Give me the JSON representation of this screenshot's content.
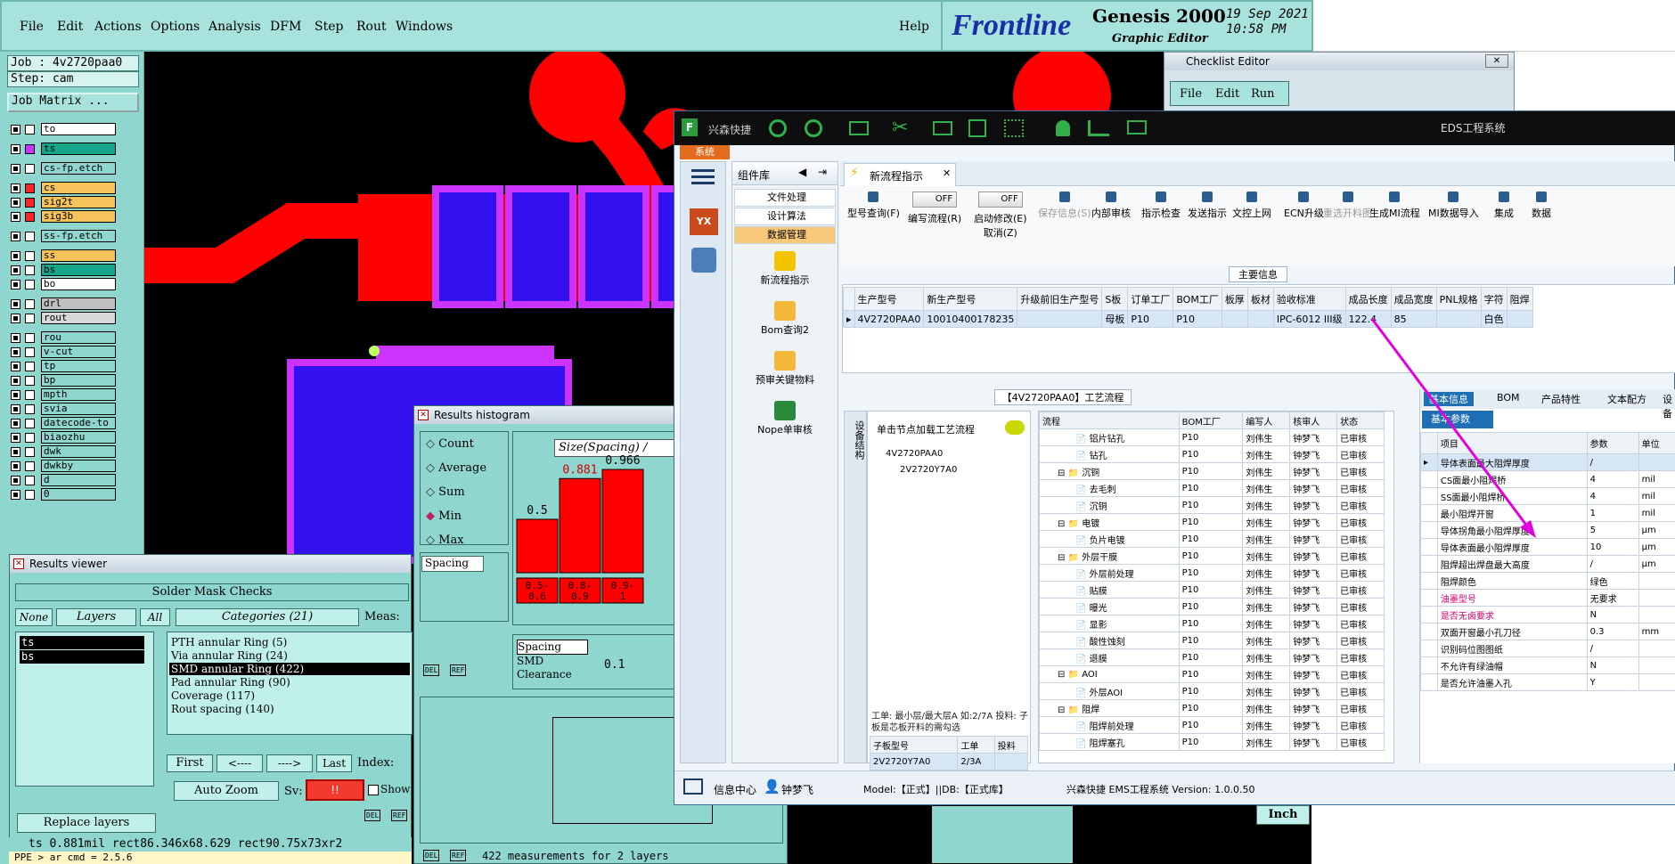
{
  "genesis": {
    "menu": [
      "File",
      "Edit",
      "Actions",
      "Options",
      "Analysis",
      "DFM",
      "Step",
      "Rout",
      "Windows"
    ],
    "help": "Help",
    "brand": "Frontline",
    "product": "Genesis 2000",
    "subtitle": "Graphic Editor",
    "date": "19 Sep 2021",
    "time": "10:58 PM",
    "job": "Job : 4v2720paa0",
    "step": "Step: cam",
    "job_matrix": "Job Matrix ...",
    "layers": [
      {
        "name": "to",
        "color": "#ffffff"
      },
      {
        "name": "ts",
        "color": "#17a589"
      },
      {
        "name": "cs-fp.etch",
        "color": "#8fd6cf"
      },
      {
        "name": "cs",
        "color": "#f6c35a"
      },
      {
        "name": "sig2t",
        "color": "#f6c35a"
      },
      {
        "name": "sig3b",
        "color": "#f6c35a"
      },
      {
        "name": "ss-fp.etch",
        "color": "#8fd6cf"
      },
      {
        "name": "ss",
        "color": "#f6c35a"
      },
      {
        "name": "bs",
        "color": "#17a589"
      },
      {
        "name": "bo",
        "color": "#ffffff"
      },
      {
        "name": "drl",
        "color": "#c0c0c0"
      },
      {
        "name": "rout",
        "color": "#d8d8d8"
      },
      {
        "name": "rou",
        "color": "#8fd6cf"
      },
      {
        "name": "v-cut",
        "color": "#8fd6cf"
      },
      {
        "name": "tp",
        "color": "#8fd6cf"
      },
      {
        "name": "bp",
        "color": "#8fd6cf"
      },
      {
        "name": "mpth",
        "color": "#8fd6cf"
      },
      {
        "name": "svia",
        "color": "#8fd6cf"
      },
      {
        "name": "datecode-to",
        "color": "#8fd6cf"
      },
      {
        "name": "biaozhu",
        "color": "#8fd6cf"
      },
      {
        "name": "dwk",
        "color": "#8fd6cf"
      },
      {
        "name": "dwkby",
        "color": "#8fd6cf"
      },
      {
        "name": "d",
        "color": "#8fd6cf"
      },
      {
        "name": "0",
        "color": "#8fd6cf"
      }
    ],
    "results_viewer": {
      "title": "Results viewer",
      "header": "Solder Mask Checks",
      "none": "None",
      "layers": "Layers",
      "all": "All",
      "categories": "Categories (21)",
      "meas": "Meas:",
      "layer_list": [
        "ts",
        "bs"
      ],
      "cats": [
        "PTH annular Ring (5)",
        "Via annular Ring (24)",
        "SMD annular Ring (422)",
        "Pad annular Ring (90)",
        "Coverage (117)",
        "Rout spacing (140)"
      ],
      "first": "First",
      "prev": "<----",
      "next": "---->",
      "last": "Last",
      "index": "Index:",
      "auto_zoom": "Auto Zoom",
      "sv": "Sv:",
      "sv_val": "!!",
      "show": "Show",
      "replace": "Replace layers",
      "del": "DEL",
      "ref": "REF",
      "status1": "ts  0.881mil   rect86.346x68.629   rect90.75x73xr2",
      "status2": "PPE  > ar cmd = 2.5.6"
    },
    "histogram": {
      "title": "Results histogram",
      "options": [
        "Count",
        "Average",
        "Sum",
        "Min",
        "Max"
      ],
      "chart_title": "Size(Spacing) /",
      "spacing": "Spacing",
      "types": [
        "Spacing",
        "SMD",
        "Clearance"
      ],
      "min_val": "0.1",
      "measurements": "422 measurements for 2 layers",
      "del": "DEL",
      "ref": "REF",
      "inch": "Inch"
    },
    "checklist": {
      "title": "Checklist Editor",
      "menu": [
        "File",
        "Edit",
        "Run"
      ]
    }
  },
  "chart_data": {
    "type": "bar",
    "title": "Size(Spacing) /",
    "categories": [
      "0.5-0.6",
      "0.8-0.9",
      "0.9-1"
    ],
    "data_labels": [
      "0.5",
      "0.881",
      "0.966"
    ],
    "values": [
      0.5,
      0.881,
      0.966
    ]
  },
  "eds": {
    "app_name": "兴森快捷",
    "window_title": "EDS工程系统",
    "system_tab": "系统",
    "sidebar_title": "组件库",
    "sidebar_items": [
      "文件处理",
      "设计算法",
      "数据管理"
    ],
    "sidebar_icons": [
      "新流程指示",
      "Bom查询2",
      "预审关键物料",
      "Nope单审核"
    ],
    "tab": "新流程指示",
    "toolbar": [
      "型号查询(F)",
      "编写流程(R)",
      "启动修改(E)",
      "保存信息(S)",
      "内部审核",
      "指示检查",
      "发送指示",
      "文控上网",
      "ECN升级",
      "重选开料图",
      "生成MI流程",
      "MI数据导入",
      "集成",
      "数据"
    ],
    "toolbar_extra": "取消(Z)",
    "off": "OFF",
    "main_info": "主要信息",
    "main_cols": [
      "生产型号",
      "新生产型号",
      "升级前旧生产型号",
      "S板",
      "订单工厂",
      "BOM工厂",
      "板厚",
      "板材",
      "验收标准",
      "成品长度",
      "成品宽度",
      "PNL规格",
      "字符",
      "阻焊"
    ],
    "main_row": [
      "4V2720PAA0",
      "10010400178235",
      "",
      "母板",
      "P10",
      "P10",
      "",
      "",
      "IPC-6012 III级",
      "122.4",
      "85",
      "",
      "白色",
      ""
    ],
    "flow_title": "【4V2720PAA0】工艺流程",
    "tree_hint": "单击节点加载工艺流程",
    "tree": [
      "4V2720PAA0",
      "2V2720Y7A0"
    ],
    "vertical_tab": "设备结构",
    "note": "工单: 最小层/最大层A 如:2/7A 投料: 子板是芯板开料的需勾选",
    "sub_cols": [
      "子板型号",
      "工单",
      "投料"
    ],
    "sub_row": [
      "2V2720Y7A0",
      "2/3A",
      ""
    ],
    "flow_cols": [
      "流程",
      "BOM工厂",
      "编写人",
      "核审人",
      "状态"
    ],
    "flow_rows": [
      {
        "name": "铝片钻孔",
        "lvl": 2,
        "bom": "P10",
        "w": "刘伟生",
        "r": "钟梦飞",
        "s": "已审核"
      },
      {
        "name": "钻孔",
        "lvl": 2,
        "bom": "P10",
        "w": "刘伟生",
        "r": "钟梦飞",
        "s": "已审核"
      },
      {
        "name": "沉铜",
        "lvl": 1,
        "bom": "P10",
        "w": "刘伟生",
        "r": "钟梦飞",
        "s": "已审核"
      },
      {
        "name": "去毛刺",
        "lvl": 2,
        "bom": "P10",
        "w": "刘伟生",
        "r": "钟梦飞",
        "s": "已审核"
      },
      {
        "name": "沉铜",
        "lvl": 2,
        "bom": "P10",
        "w": "刘伟生",
        "r": "钟梦飞",
        "s": "已审核"
      },
      {
        "name": "电镀",
        "lvl": 1,
        "bom": "P10",
        "w": "刘伟生",
        "r": "钟梦飞",
        "s": "已审核"
      },
      {
        "name": "负片电镀",
        "lvl": 2,
        "bom": "P10",
        "w": "刘伟生",
        "r": "钟梦飞",
        "s": "已审核"
      },
      {
        "name": "外层干膜",
        "lvl": 1,
        "bom": "P10",
        "w": "刘伟生",
        "r": "钟梦飞",
        "s": "已审核"
      },
      {
        "name": "外层前处理",
        "lvl": 2,
        "bom": "P10",
        "w": "刘伟生",
        "r": "钟梦飞",
        "s": "已审核"
      },
      {
        "name": "贴膜",
        "lvl": 2,
        "bom": "P10",
        "w": "刘伟生",
        "r": "钟梦飞",
        "s": "已审核"
      },
      {
        "name": "曝光",
        "lvl": 2,
        "bom": "P10",
        "w": "刘伟生",
        "r": "钟梦飞",
        "s": "已审核"
      },
      {
        "name": "显影",
        "lvl": 2,
        "bom": "P10",
        "w": "刘伟生",
        "r": "钟梦飞",
        "s": "已审核"
      },
      {
        "name": "酸性蚀刻",
        "lvl": 2,
        "bom": "P10",
        "w": "刘伟生",
        "r": "钟梦飞",
        "s": "已审核"
      },
      {
        "name": "退膜",
        "lvl": 2,
        "bom": "P10",
        "w": "刘伟生",
        "r": "钟梦飞",
        "s": "已审核"
      },
      {
        "name": "AOI",
        "lvl": 1,
        "bom": "P10",
        "w": "刘伟生",
        "r": "钟梦飞",
        "s": "已审核"
      },
      {
        "name": "外层AOI",
        "lvl": 2,
        "bom": "P10",
        "w": "刘伟生",
        "r": "钟梦飞",
        "s": "已审核"
      },
      {
        "name": "阻焊",
        "lvl": 1,
        "bom": "P10",
        "w": "刘伟生",
        "r": "钟梦飞",
        "s": "已审核"
      },
      {
        "name": "阻焊前处理",
        "lvl": 2,
        "bom": "P10",
        "w": "刘伟生",
        "r": "钟梦飞",
        "s": "已审核"
      },
      {
        "name": "阻焊塞孔",
        "lvl": 2,
        "bom": "P10",
        "w": "刘伟生",
        "r": "钟梦飞",
        "s": "已审核"
      }
    ],
    "right_tabs": [
      "基本信息",
      "BOM",
      "产品特性",
      "文本配方",
      "设备"
    ],
    "right_subtab": "基本参数",
    "param_cols": [
      "项目",
      "参数",
      "单位"
    ],
    "params": [
      {
        "item": "导体表面最大阻焊厚度",
        "val": "/",
        "unit": "",
        "red": false
      },
      {
        "item": "CS面最小阻焊桥",
        "val": "4",
        "unit": "mil",
        "red": false
      },
      {
        "item": "SS面最小阻焊桥",
        "val": "4",
        "unit": "mil",
        "red": false
      },
      {
        "item": "最小阻焊开窗",
        "val": "1",
        "unit": "mil",
        "red": false
      },
      {
        "item": "导体拐角最小阻焊厚度",
        "val": "5",
        "unit": "μm",
        "red": false
      },
      {
        "item": "导体表面最小阻焊厚度",
        "val": "10",
        "unit": "μm",
        "red": false
      },
      {
        "item": "阻焊超出焊盘最大高度",
        "val": "/",
        "unit": "μm",
        "red": false
      },
      {
        "item": "阻焊颜色",
        "val": "绿色",
        "unit": "",
        "red": false
      },
      {
        "item": "油墨型号",
        "val": "无要求",
        "unit": "",
        "red": true
      },
      {
        "item": "是否无卤要求",
        "val": "N",
        "unit": "",
        "red": true
      },
      {
        "item": "双面开窗最小孔刀径",
        "val": "0.3",
        "unit": "mm",
        "red": false
      },
      {
        "item": "识别码位图图纸",
        "val": "/",
        "unit": "",
        "red": false
      },
      {
        "item": "不允许有绿油帽",
        "val": "N",
        "unit": "",
        "red": false
      },
      {
        "item": "是否允许油墨入孔",
        "val": "Y",
        "unit": "",
        "red": false
      }
    ],
    "status_info": "信息中心",
    "status_user": "钟梦飞",
    "status_model": "Model:【正式】||DB:【正式库】",
    "status_version": "兴森快捷 EMS工程系统 Version: 1.0.0.50"
  }
}
